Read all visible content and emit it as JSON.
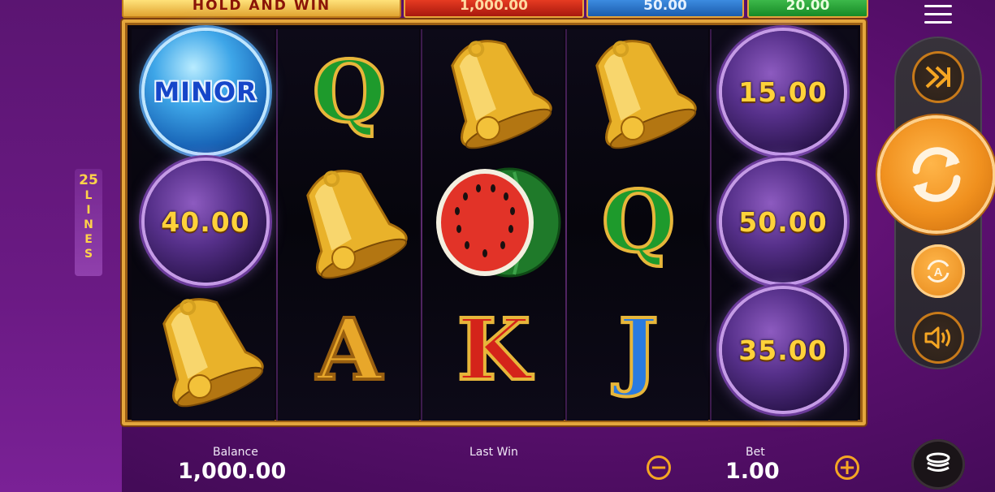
{
  "jackpots": {
    "title": "HOLD AND WIN",
    "major": "1,000.00",
    "minor": "50.00",
    "mini": "20.00"
  },
  "lines": {
    "count": "25",
    "word": [
      "L",
      "I",
      "N",
      "E",
      "S"
    ]
  },
  "reels": [
    [
      {
        "type": "coin-minor",
        "label": "MINOR"
      },
      {
        "type": "coin",
        "label": "40.00"
      },
      {
        "type": "bell"
      }
    ],
    [
      {
        "type": "letter",
        "label": "Q"
      },
      {
        "type": "bell"
      },
      {
        "type": "letter",
        "label": "A"
      }
    ],
    [
      {
        "type": "bell"
      },
      {
        "type": "watermelon"
      },
      {
        "type": "letter",
        "label": "K"
      }
    ],
    [
      {
        "type": "bell"
      },
      {
        "type": "letter",
        "label": "Q"
      },
      {
        "type": "letter",
        "label": "J"
      }
    ],
    [
      {
        "type": "coin",
        "label": "15.00"
      },
      {
        "type": "coin",
        "label": "50.00"
      },
      {
        "type": "coin",
        "label": "35.00"
      }
    ]
  ],
  "bottom": {
    "balance_label": "Balance",
    "balance_value": "1,000.00",
    "lastwin_label": "Last Win",
    "bet_label": "Bet",
    "bet_value": "1.00",
    "minus": "−",
    "plus": "+"
  },
  "controls": {
    "icons": [
      "menu-icon",
      "fast-forward-icon",
      "spin-icon",
      "autoplay-icon",
      "sound-icon",
      "coins-icon"
    ],
    "autoplay_letter": "A"
  },
  "colors": {
    "accent_orange": "#f5a623",
    "frame_gold": "#e4a63c",
    "background_purple": "#5a0f6e"
  }
}
